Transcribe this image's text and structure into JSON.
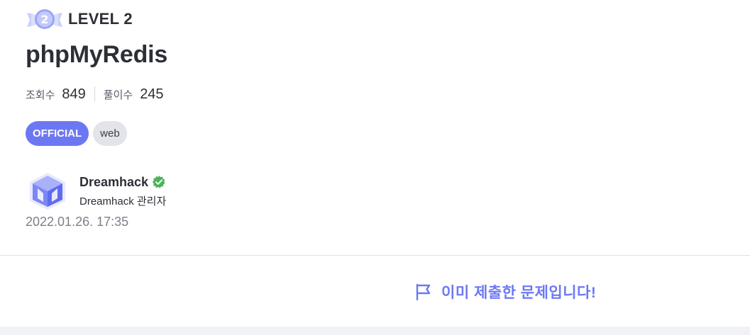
{
  "level": {
    "badge_number": "2",
    "label": "LEVEL 2"
  },
  "title": "phpMyRedis",
  "stats": {
    "views_label": "조회수",
    "views_value": "849",
    "solves_label": "풀이수",
    "solves_value": "245"
  },
  "tags": [
    "OFFICIAL",
    "web"
  ],
  "author": {
    "name": "Dreamhack",
    "role": "Dreamhack 관리자",
    "logo_icon": "dreamhack-logo-icon",
    "verified_icon": "verified-badge-icon"
  },
  "date": "2022.01.26. 17:35",
  "submitted": {
    "icon": "flag-icon",
    "text": "이미 제출한 문제입니다!"
  },
  "colors": {
    "accent": "#6c78f3",
    "verified": "#4bb35a",
    "tag_bg": "#e2e4ea",
    "text_dark": "#2c2f36",
    "text_muted": "#7a808a"
  }
}
